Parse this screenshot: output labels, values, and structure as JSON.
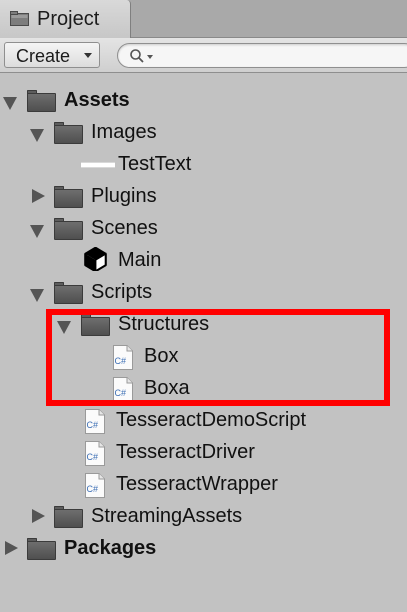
{
  "window": {
    "tab_label": "Project"
  },
  "toolbar": {
    "create_label": "Create",
    "search_value": "",
    "search_placeholder": ""
  },
  "tree": {
    "assets": {
      "label": "Assets",
      "expanded": true,
      "icon": "folder-icon"
    },
    "images": {
      "label": "Images",
      "expanded": true,
      "icon": "folder-icon"
    },
    "testtext": {
      "label": "TestText",
      "icon": "text-asset-icon"
    },
    "plugins": {
      "label": "Plugins",
      "expanded": false,
      "icon": "folder-icon"
    },
    "scenes": {
      "label": "Scenes",
      "expanded": true,
      "icon": "folder-icon"
    },
    "main": {
      "label": "Main",
      "icon": "unity-scene-icon"
    },
    "scripts": {
      "label": "Scripts",
      "expanded": true,
      "icon": "folder-icon"
    },
    "structures": {
      "label": "Structures",
      "expanded": true,
      "icon": "folder-icon"
    },
    "box": {
      "label": "Box",
      "icon": "csharp-file-icon"
    },
    "boxa": {
      "label": "Boxa",
      "icon": "csharp-file-icon"
    },
    "tesseractdemoscript": {
      "label": "TesseractDemoScript",
      "icon": "csharp-file-icon"
    },
    "tesseractdriver": {
      "label": "TesseractDriver",
      "icon": "csharp-file-icon"
    },
    "tesseractwrapper": {
      "label": "TesseractWrapper",
      "icon": "csharp-file-icon"
    },
    "streamingassets": {
      "label": "StreamingAssets",
      "expanded": false,
      "icon": "folder-icon"
    },
    "packages": {
      "label": "Packages",
      "expanded": false,
      "icon": "folder-icon"
    }
  },
  "csharp_icon_text": "C#",
  "colors": {
    "panel_background": "#c2c2c2",
    "highlight": "#ff0000",
    "folder": "#5a5a5a",
    "csharp_text": "#3d6fb5"
  }
}
